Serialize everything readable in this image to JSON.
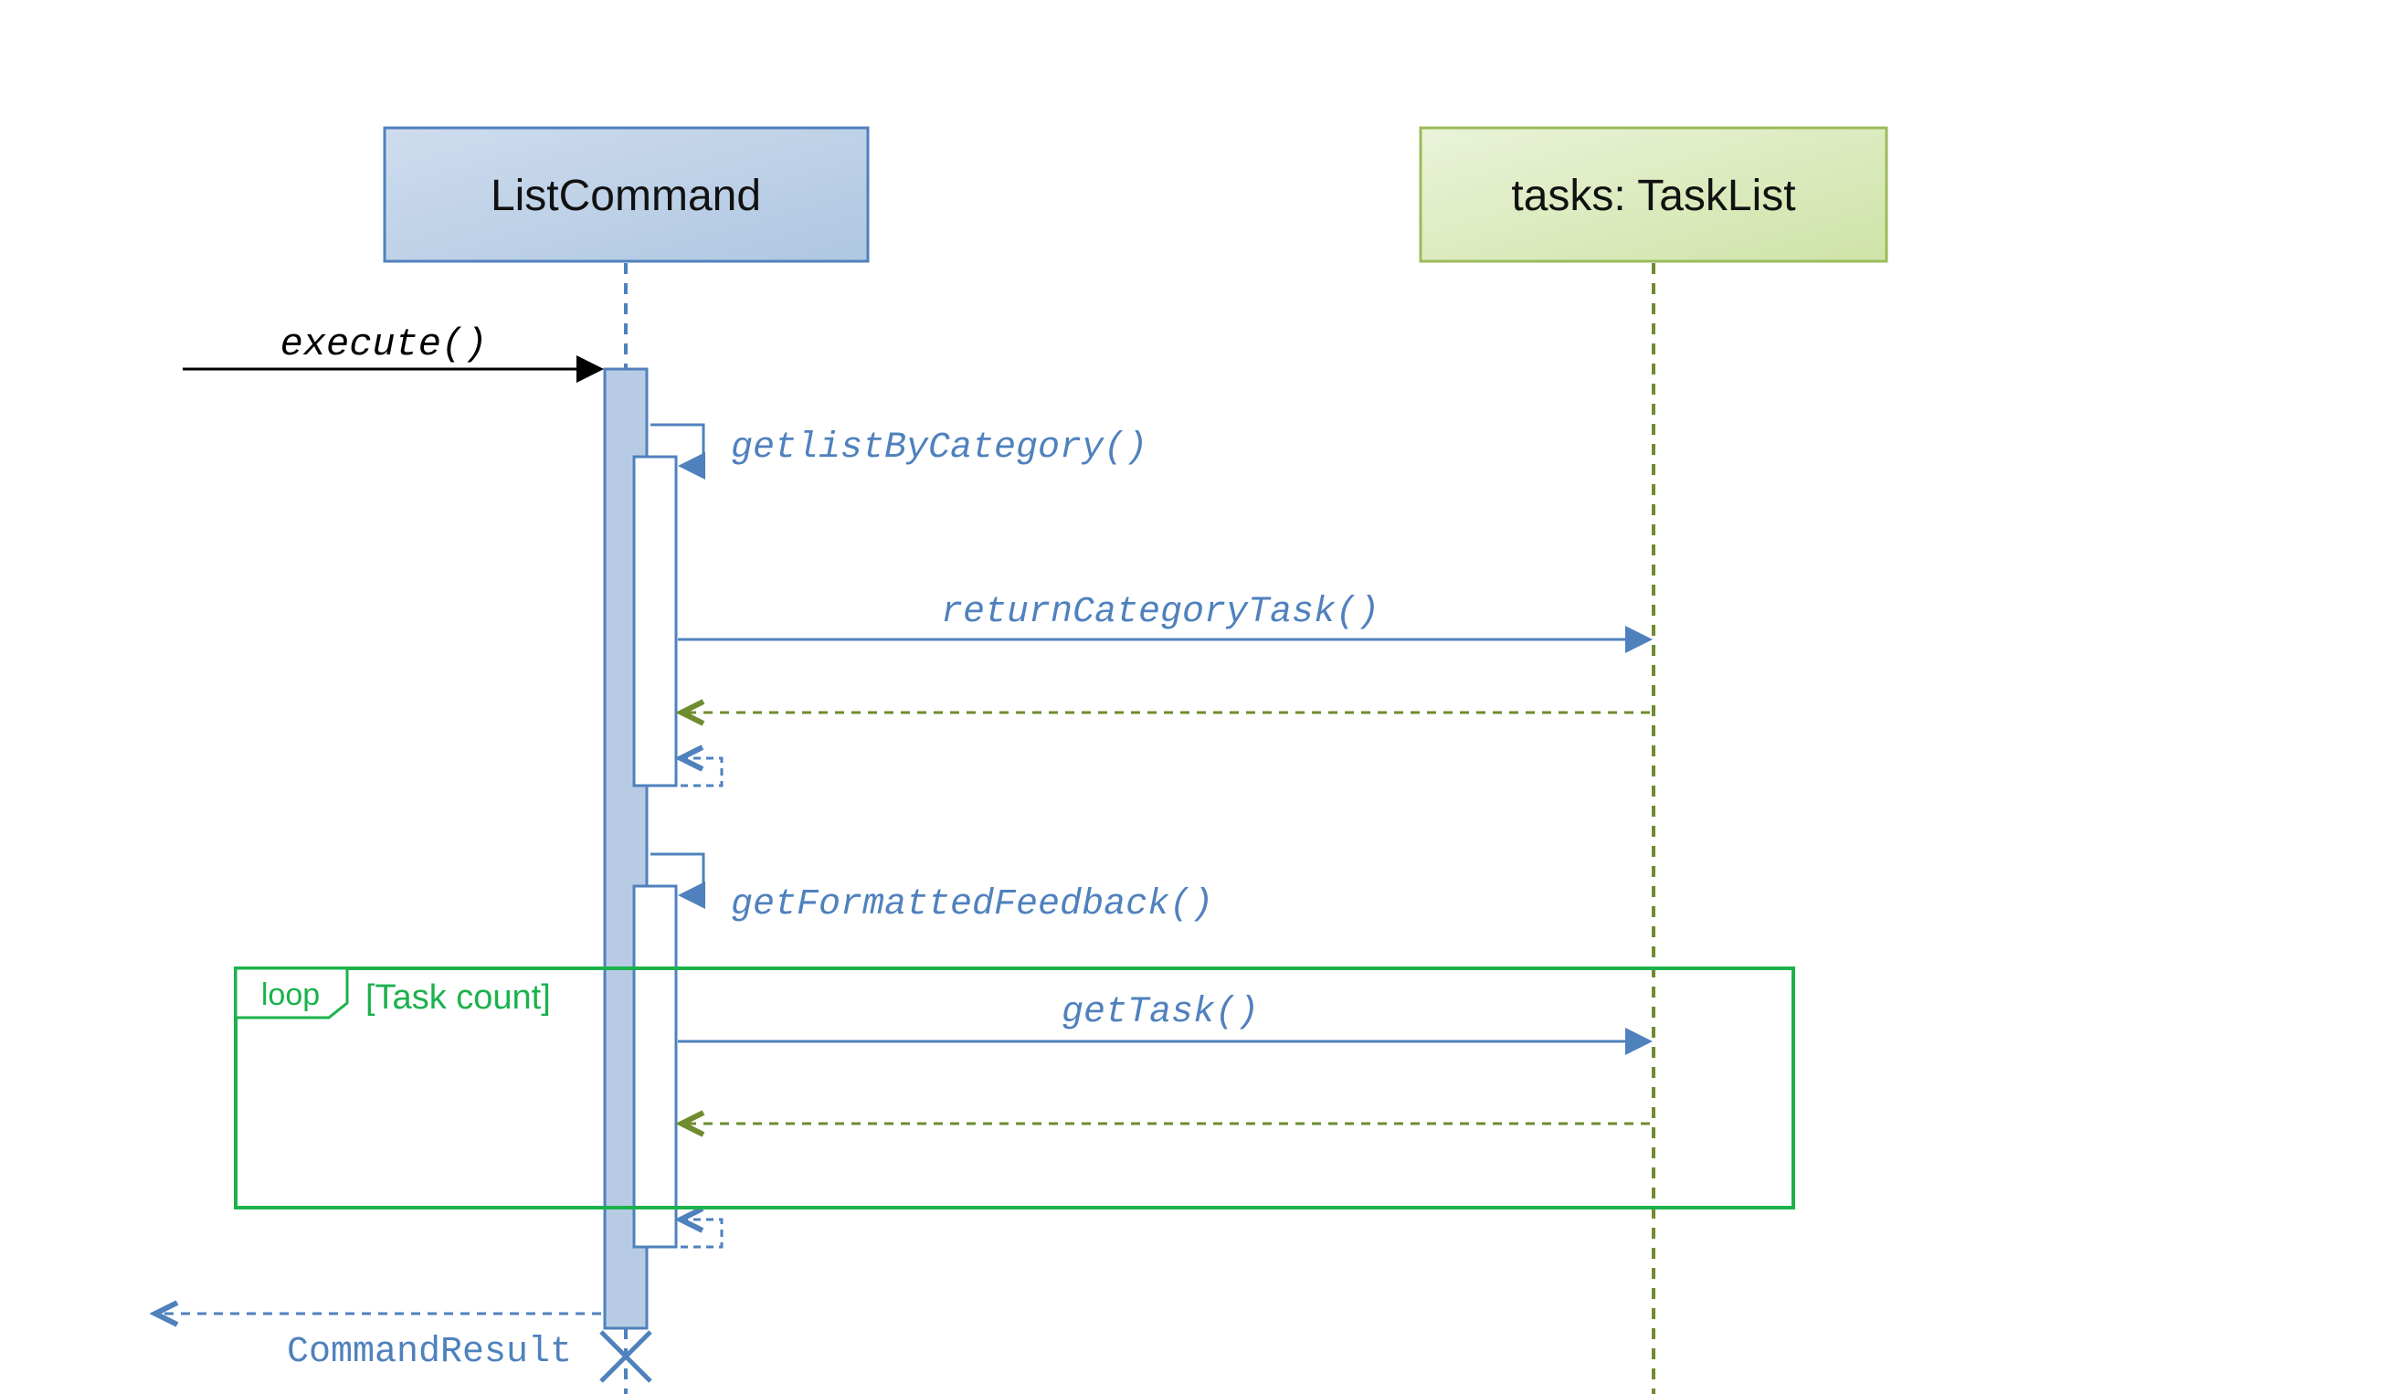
{
  "participants": {
    "listCommand": {
      "label": "ListCommand"
    },
    "taskList": {
      "label": "tasks: TaskList"
    }
  },
  "messages": {
    "execute": "execute()",
    "getListByCategory": "getlistByCategory()",
    "returnCategoryTask": "returnCategoryTask()",
    "getFormattedFeedback": "getFormattedFeedback()",
    "getTask": "getTask()",
    "commandResult": "CommandResult"
  },
  "fragment": {
    "operator": "loop",
    "guard": "[Task count]"
  },
  "colors": {
    "blueFill": "#b7cce4",
    "blueStroke": "#4f81bd",
    "blueText": "#4f81bd",
    "greenFill": "#d7e4bd",
    "greenStroke": "#9bbb59",
    "darkGreen": "#6f8c2e",
    "fragGreen": "#1bb24c",
    "black": "#000000"
  }
}
